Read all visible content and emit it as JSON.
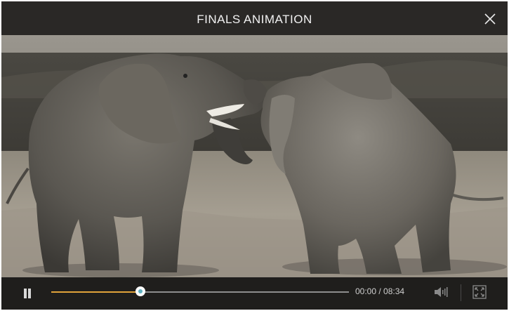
{
  "window": {
    "title": "FINALS ANIMATION"
  },
  "player": {
    "current_time": "00:00",
    "separator": " / ",
    "duration": "08:34",
    "progress_fraction": 0.3
  },
  "icons": {
    "close": "close-icon",
    "pause": "pause-icon",
    "volume": "volume-icon",
    "fullscreen": "fullscreen-icon"
  },
  "colors": {
    "progress_played": "#e0a33a",
    "knob_center": "#5fb0c0",
    "track": "#8e8e8e"
  }
}
